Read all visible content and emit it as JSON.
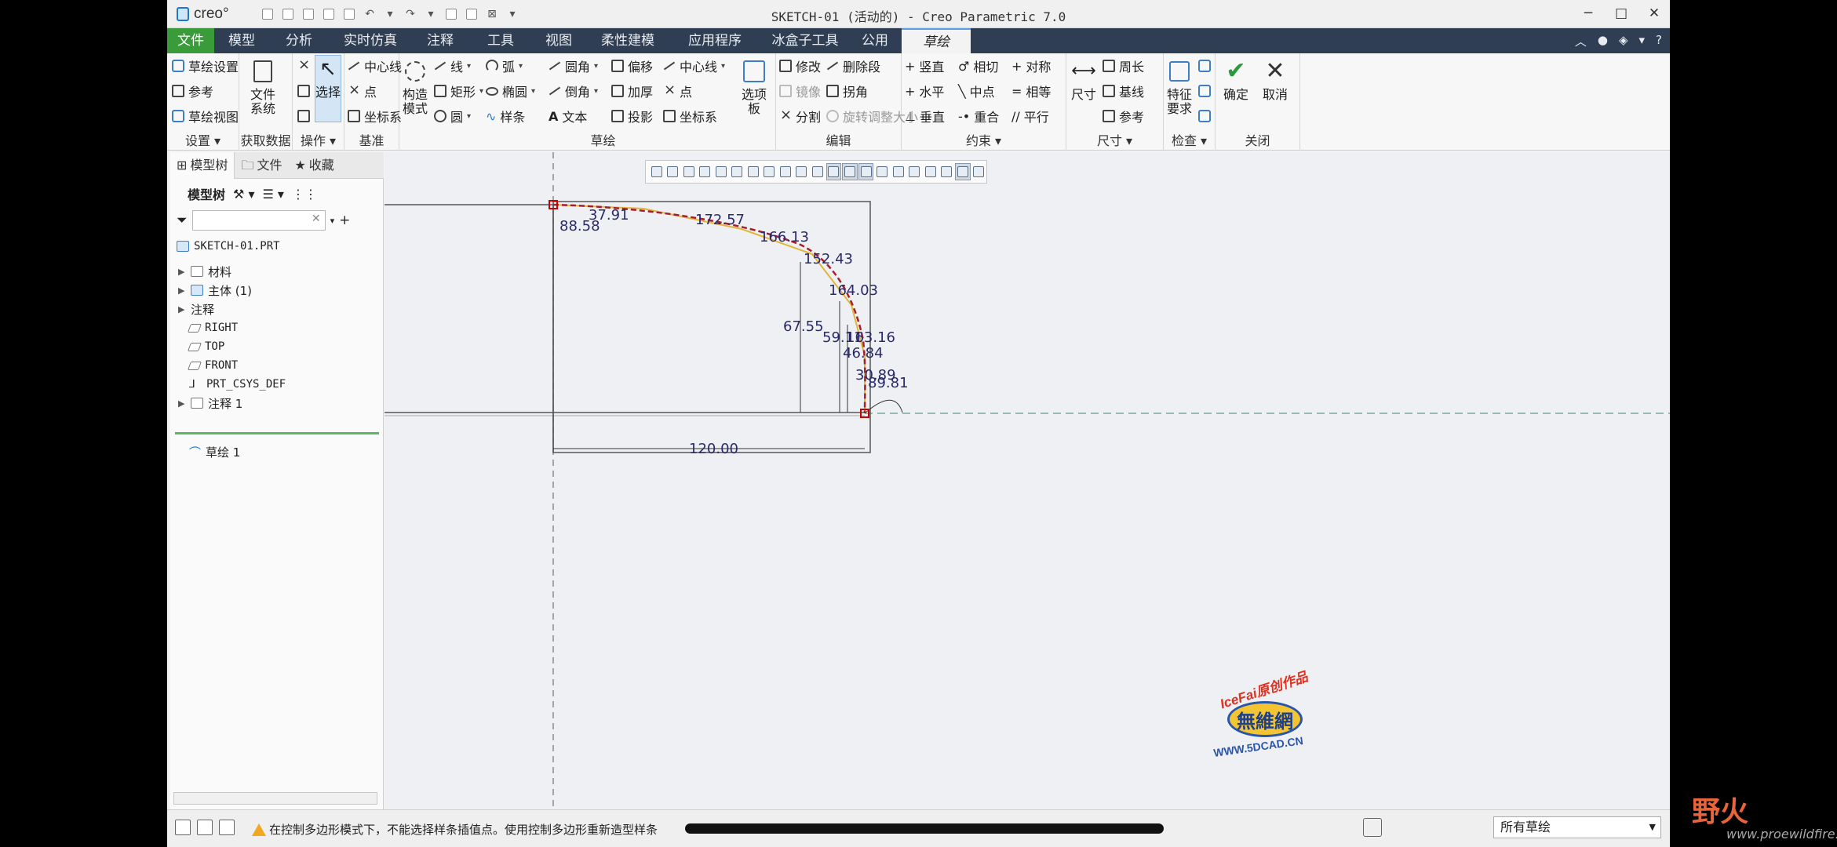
{
  "titlebar": {
    "logo": "creo°",
    "title": "SKETCH-01 (活动的) - Creo Parametric 7.0",
    "controls": [
      "─",
      "□",
      "✕"
    ]
  },
  "tabs": {
    "file": "文件",
    "items": [
      "模型",
      "分析",
      "实时仿真",
      "注释",
      "工具",
      "视图",
      "柔性建模",
      "应用程序",
      "冰盒子工具",
      "公用"
    ],
    "active": "草绘"
  },
  "ribbon": {
    "setup": {
      "items": [
        "草绘设置",
        "参考",
        "草绘视图"
      ],
      "label": "设置 ▾"
    },
    "getdata": {
      "btn": [
        "文件",
        "系统"
      ],
      "label": "获取数据"
    },
    "ops": {
      "select": "选择",
      "label": "操作 ▾"
    },
    "datum": {
      "items": [
        "中心线",
        "点",
        "坐标系"
      ],
      "label": "基准"
    },
    "construct": {
      "btn": [
        "构造",
        "模式"
      ]
    },
    "sketch": {
      "col1": [
        "线",
        "矩形",
        "圆"
      ],
      "col2": [
        "弧",
        "椭圆",
        "样条"
      ],
      "col3": [
        "圆角",
        "倒角",
        "文本"
      ],
      "col4": [
        "偏移",
        "加厚",
        "投影"
      ],
      "col5": [
        "中心线",
        "点",
        "坐标系"
      ],
      "palette": [
        "选项",
        "板"
      ],
      "label": "草绘"
    },
    "edit": {
      "col1": [
        "修改",
        "镜像",
        "分割"
      ],
      "col2": [
        "删除段",
        "拐角",
        "旋转调整大小"
      ],
      "label": "编辑"
    },
    "constrain": {
      "col1": [
        "竖直",
        "水平",
        "垂直"
      ],
      "col2": [
        "相切",
        "中点",
        "重合"
      ],
      "col3": [
        "对称",
        "相等",
        "平行"
      ],
      "label": "约束 ▾"
    },
    "dimension": {
      "big": "尺寸",
      "items": [
        "周长",
        "基线",
        "参考"
      ],
      "label": "尺寸 ▾"
    },
    "inspect": {
      "btn": [
        "特征",
        "要求"
      ],
      "label": "检查 ▾"
    },
    "close": {
      "ok": "确定",
      "cancel": "取消",
      "label": "关闭"
    }
  },
  "leftpanel": {
    "tabs": [
      "模型树",
      "文件",
      "收藏"
    ],
    "tree_header": "模型树",
    "items": [
      "SKETCH-01.PRT",
      "材料",
      "主体 (1)",
      "注释",
      "RIGHT",
      "TOP",
      "FRONT",
      "PRT_CSYS_DEF",
      "注释 1",
      "草绘 1"
    ]
  },
  "sketch": {
    "dims": [
      "37.91",
      "88.58",
      "172.57",
      "166.13",
      "152.43",
      "164.03",
      "67.55",
      "59.11",
      "163.16",
      "46.84",
      "30.89",
      "89.81",
      "120.00"
    ]
  },
  "watermark": {
    "top": "IceFai原创作品",
    "mid": "無維網",
    "bottom": "WWW.5DCAD.CN"
  },
  "statusbar": {
    "message": "在控制多边形模式下，不能选择样条插值点。使用控制多边形重新造型样条",
    "filter": "所有草绘"
  },
  "overlay": {
    "brand": "野火",
    "url": "www.proewildfire.cn"
  },
  "colors": {
    "tabbar": "#2f3e52",
    "file_tab": "#3a9b3a",
    "spline": "#b0202a",
    "dim": "#2a2a6a"
  }
}
